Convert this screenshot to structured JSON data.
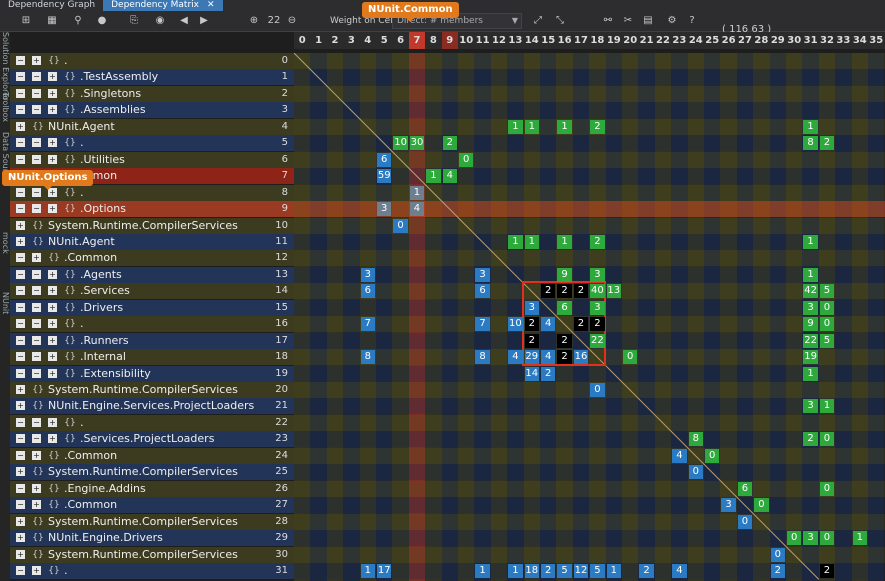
{
  "tabs": [
    {
      "label": "Dependency Graph",
      "active": false
    },
    {
      "label": "Dependency Matrix",
      "active": true
    }
  ],
  "toolbar": {
    "weight_label": "Weight on Cells:",
    "weight_value": "Direct: # members",
    "zoom_value": "22",
    "counts": "( 116  63 )"
  },
  "side_strips": [
    "Solution Explorer",
    "Toolbox",
    "Data Sources",
    "mock",
    "NUnit"
  ],
  "callouts": {
    "column": "NUnit.Common",
    "row": "NUnit.Options"
  },
  "columns": [
    "0",
    "1",
    "2",
    "3",
    "4",
    "5",
    "6",
    "7",
    "8",
    "9",
    "10",
    "11",
    "12",
    "13",
    "14",
    "15",
    "16",
    "17",
    "18",
    "19",
    "20",
    "21",
    "22",
    "23",
    "24",
    "25",
    "26",
    "27",
    "28",
    "29",
    "30",
    "31",
    "32",
    "33",
    "34",
    "35"
  ],
  "rows": [
    {
      "i": "0",
      "label": ".",
      "indent": 2
    },
    {
      "i": "1",
      "label": ".TestAssembly",
      "indent": 3
    },
    {
      "i": "2",
      "label": ".Singletons",
      "indent": 3
    },
    {
      "i": "3",
      "label": ".Assemblies",
      "indent": 3
    },
    {
      "i": "4",
      "label": "NUnit.Agent",
      "indent": 1
    },
    {
      "i": "5",
      "label": ".",
      "indent": 3
    },
    {
      "i": "6",
      "label": ".Utilities",
      "indent": 3
    },
    {
      "i": "7",
      "label": ".Common",
      "indent": 2
    },
    {
      "i": "8",
      "label": ".",
      "indent": 3
    },
    {
      "i": "9",
      "label": ".Options",
      "indent": 3
    },
    {
      "i": "10",
      "label": "System.Runtime.CompilerServices",
      "indent": 1
    },
    {
      "i": "11",
      "label": "NUnit.Agent",
      "indent": 1
    },
    {
      "i": "12",
      "label": ".Common",
      "indent": 2
    },
    {
      "i": "13",
      "label": ".Agents",
      "indent": 3
    },
    {
      "i": "14",
      "label": ".Services",
      "indent": 3
    },
    {
      "i": "15",
      "label": ".Drivers",
      "indent": 3
    },
    {
      "i": "16",
      "label": ".",
      "indent": 3
    },
    {
      "i": "17",
      "label": ".Runners",
      "indent": 3
    },
    {
      "i": "18",
      "label": ".Internal",
      "indent": 3
    },
    {
      "i": "19",
      "label": ".Extensibility",
      "indent": 3
    },
    {
      "i": "20",
      "label": "System.Runtime.CompilerServices",
      "indent": 1
    },
    {
      "i": "21",
      "label": "NUnit.Engine.Services.ProjectLoaders",
      "indent": 1
    },
    {
      "i": "22",
      "label": ".",
      "indent": 3
    },
    {
      "i": "23",
      "label": ".Services.ProjectLoaders",
      "indent": 3
    },
    {
      "i": "24",
      "label": ".Common",
      "indent": 2
    },
    {
      "i": "25",
      "label": "System.Runtime.CompilerServices",
      "indent": 1
    },
    {
      "i": "26",
      "label": ".Engine.Addins",
      "indent": 2
    },
    {
      "i": "27",
      "label": ".Common",
      "indent": 2
    },
    {
      "i": "28",
      "label": "System.Runtime.CompilerServices",
      "indent": 1
    },
    {
      "i": "29",
      "label": "NUnit.Engine.Drivers",
      "indent": 1
    },
    {
      "i": "30",
      "label": "System.Runtime.CompilerServices",
      "indent": 1
    },
    {
      "i": "31",
      "label": ".",
      "indent": 2
    }
  ],
  "cells": [
    {
      "r": 4,
      "c": 13,
      "v": "1",
      "t": "g"
    },
    {
      "r": 4,
      "c": 14,
      "v": "1",
      "t": "g"
    },
    {
      "r": 4,
      "c": 16,
      "v": "1",
      "t": "g"
    },
    {
      "r": 4,
      "c": 18,
      "v": "2",
      "t": "g"
    },
    {
      "r": 4,
      "c": 31,
      "v": "1",
      "t": "g"
    },
    {
      "r": 5,
      "c": 6,
      "v": "10",
      "t": "g"
    },
    {
      "r": 5,
      "c": 7,
      "v": "30",
      "t": "g"
    },
    {
      "r": 5,
      "c": 9,
      "v": "2",
      "t": "g"
    },
    {
      "r": 5,
      "c": 31,
      "v": "8",
      "t": "g"
    },
    {
      "r": 5,
      "c": 32,
      "v": "2",
      "t": "g"
    },
    {
      "r": 6,
      "c": 5,
      "v": "6",
      "t": "b"
    },
    {
      "r": 6,
      "c": 10,
      "v": "0",
      "t": "g"
    },
    {
      "r": 7,
      "c": 5,
      "v": "59",
      "t": "b"
    },
    {
      "r": 7,
      "c": 8,
      "v": "1",
      "t": "g"
    },
    {
      "r": 7,
      "c": 9,
      "v": "4",
      "t": "g"
    },
    {
      "r": 8,
      "c": 7,
      "v": "1",
      "t": "gy"
    },
    {
      "r": 9,
      "c": 5,
      "v": "3",
      "t": "gy"
    },
    {
      "r": 9,
      "c": 7,
      "v": "4",
      "t": "gy"
    },
    {
      "r": 10,
      "c": 6,
      "v": "0",
      "t": "b"
    },
    {
      "r": 11,
      "c": 13,
      "v": "1",
      "t": "g"
    },
    {
      "r": 11,
      "c": 14,
      "v": "1",
      "t": "g"
    },
    {
      "r": 11,
      "c": 16,
      "v": "1",
      "t": "g"
    },
    {
      "r": 11,
      "c": 18,
      "v": "2",
      "t": "g"
    },
    {
      "r": 11,
      "c": 31,
      "v": "1",
      "t": "g"
    },
    {
      "r": 13,
      "c": 4,
      "v": "3",
      "t": "b"
    },
    {
      "r": 13,
      "c": 11,
      "v": "3",
      "t": "b"
    },
    {
      "r": 13,
      "c": 16,
      "v": "9",
      "t": "g"
    },
    {
      "r": 13,
      "c": 18,
      "v": "3",
      "t": "g"
    },
    {
      "r": 13,
      "c": 31,
      "v": "1",
      "t": "g"
    },
    {
      "r": 14,
      "c": 4,
      "v": "6",
      "t": "b"
    },
    {
      "r": 14,
      "c": 11,
      "v": "6",
      "t": "b"
    },
    {
      "r": 14,
      "c": 15,
      "v": "2",
      "t": "k"
    },
    {
      "r": 14,
      "c": 16,
      "v": "2",
      "t": "k"
    },
    {
      "r": 14,
      "c": 17,
      "v": "2",
      "t": "k"
    },
    {
      "r": 14,
      "c": 18,
      "v": "40",
      "t": "g"
    },
    {
      "r": 14,
      "c": 19,
      "v": "13",
      "t": "g"
    },
    {
      "r": 14,
      "c": 31,
      "v": "42",
      "t": "g"
    },
    {
      "r": 14,
      "c": 32,
      "v": "5",
      "t": "g"
    },
    {
      "r": 15,
      "c": 14,
      "v": "3",
      "t": "b"
    },
    {
      "r": 15,
      "c": 16,
      "v": "6",
      "t": "g"
    },
    {
      "r": 15,
      "c": 18,
      "v": "3",
      "t": "g"
    },
    {
      "r": 15,
      "c": 31,
      "v": "3",
      "t": "g"
    },
    {
      "r": 15,
      "c": 32,
      "v": "0",
      "t": "g"
    },
    {
      "r": 16,
      "c": 4,
      "v": "7",
      "t": "b"
    },
    {
      "r": 16,
      "c": 11,
      "v": "7",
      "t": "b"
    },
    {
      "r": 16,
      "c": 13,
      "v": "10",
      "t": "b"
    },
    {
      "r": 16,
      "c": 14,
      "v": "2",
      "t": "k"
    },
    {
      "r": 16,
      "c": 15,
      "v": "4",
      "t": "b"
    },
    {
      "r": 16,
      "c": 17,
      "v": "2",
      "t": "k"
    },
    {
      "r": 16,
      "c": 18,
      "v": "2",
      "t": "k"
    },
    {
      "r": 16,
      "c": 31,
      "v": "9",
      "t": "g"
    },
    {
      "r": 16,
      "c": 32,
      "v": "0",
      "t": "g"
    },
    {
      "r": 17,
      "c": 14,
      "v": "2",
      "t": "k"
    },
    {
      "r": 17,
      "c": 16,
      "v": "2",
      "t": "k"
    },
    {
      "r": 17,
      "c": 18,
      "v": "22",
      "t": "g"
    },
    {
      "r": 17,
      "c": 31,
      "v": "22",
      "t": "g"
    },
    {
      "r": 17,
      "c": 32,
      "v": "5",
      "t": "g"
    },
    {
      "r": 18,
      "c": 4,
      "v": "8",
      "t": "b"
    },
    {
      "r": 18,
      "c": 11,
      "v": "8",
      "t": "b"
    },
    {
      "r": 18,
      "c": 13,
      "v": "4",
      "t": "b"
    },
    {
      "r": 18,
      "c": 14,
      "v": "29",
      "t": "b"
    },
    {
      "r": 18,
      "c": 15,
      "v": "4",
      "t": "b"
    },
    {
      "r": 18,
      "c": 16,
      "v": "2",
      "t": "k"
    },
    {
      "r": 18,
      "c": 17,
      "v": "16",
      "t": "b"
    },
    {
      "r": 18,
      "c": 20,
      "v": "0",
      "t": "g"
    },
    {
      "r": 18,
      "c": 31,
      "v": "19",
      "t": "g"
    },
    {
      "r": 19,
      "c": 14,
      "v": "14",
      "t": "b"
    },
    {
      "r": 19,
      "c": 15,
      "v": "2",
      "t": "b"
    },
    {
      "r": 19,
      "c": 31,
      "v": "1",
      "t": "g"
    },
    {
      "r": 20,
      "c": 18,
      "v": "0",
      "t": "b"
    },
    {
      "r": 21,
      "c": 31,
      "v": "3",
      "t": "g"
    },
    {
      "r": 21,
      "c": 32,
      "v": "1",
      "t": "g"
    },
    {
      "r": 23,
      "c": 24,
      "v": "8",
      "t": "g"
    },
    {
      "r": 23,
      "c": 31,
      "v": "2",
      "t": "g"
    },
    {
      "r": 23,
      "c": 32,
      "v": "0",
      "t": "g"
    },
    {
      "r": 24,
      "c": 23,
      "v": "4",
      "t": "b"
    },
    {
      "r": 24,
      "c": 25,
      "v": "0",
      "t": "g"
    },
    {
      "r": 25,
      "c": 24,
      "v": "0",
      "t": "b"
    },
    {
      "r": 26,
      "c": 27,
      "v": "6",
      "t": "g"
    },
    {
      "r": 26,
      "c": 32,
      "v": "0",
      "t": "g"
    },
    {
      "r": 27,
      "c": 26,
      "v": "3",
      "t": "b"
    },
    {
      "r": 27,
      "c": 28,
      "v": "0",
      "t": "g"
    },
    {
      "r": 28,
      "c": 27,
      "v": "0",
      "t": "b"
    },
    {
      "r": 29,
      "c": 30,
      "v": "0",
      "t": "g"
    },
    {
      "r": 29,
      "c": 31,
      "v": "3",
      "t": "g"
    },
    {
      "r": 29,
      "c": 32,
      "v": "0",
      "t": "g"
    },
    {
      "r": 29,
      "c": 34,
      "v": "1",
      "t": "g"
    },
    {
      "r": 30,
      "c": 29,
      "v": "0",
      "t": "b"
    },
    {
      "r": 31,
      "c": 4,
      "v": "1",
      "t": "b"
    },
    {
      "r": 31,
      "c": 5,
      "v": "17",
      "t": "b"
    },
    {
      "r": 31,
      "c": 11,
      "v": "1",
      "t": "b"
    },
    {
      "r": 31,
      "c": 13,
      "v": "1",
      "t": "b"
    },
    {
      "r": 31,
      "c": 14,
      "v": "18",
      "t": "b"
    },
    {
      "r": 31,
      "c": 15,
      "v": "2",
      "t": "b"
    },
    {
      "r": 31,
      "c": 16,
      "v": "5",
      "t": "b"
    },
    {
      "r": 31,
      "c": 17,
      "v": "12",
      "t": "b"
    },
    {
      "r": 31,
      "c": 18,
      "v": "5",
      "t": "b"
    },
    {
      "r": 31,
      "c": 19,
      "v": "1",
      "t": "b"
    },
    {
      "r": 31,
      "c": 21,
      "v": "2",
      "t": "b"
    },
    {
      "r": 31,
      "c": 23,
      "v": "4",
      "t": "b"
    },
    {
      "r": 31,
      "c": 29,
      "v": "2",
      "t": "b"
    },
    {
      "r": 31,
      "c": 32,
      "v": "2",
      "t": "k"
    }
  ]
}
